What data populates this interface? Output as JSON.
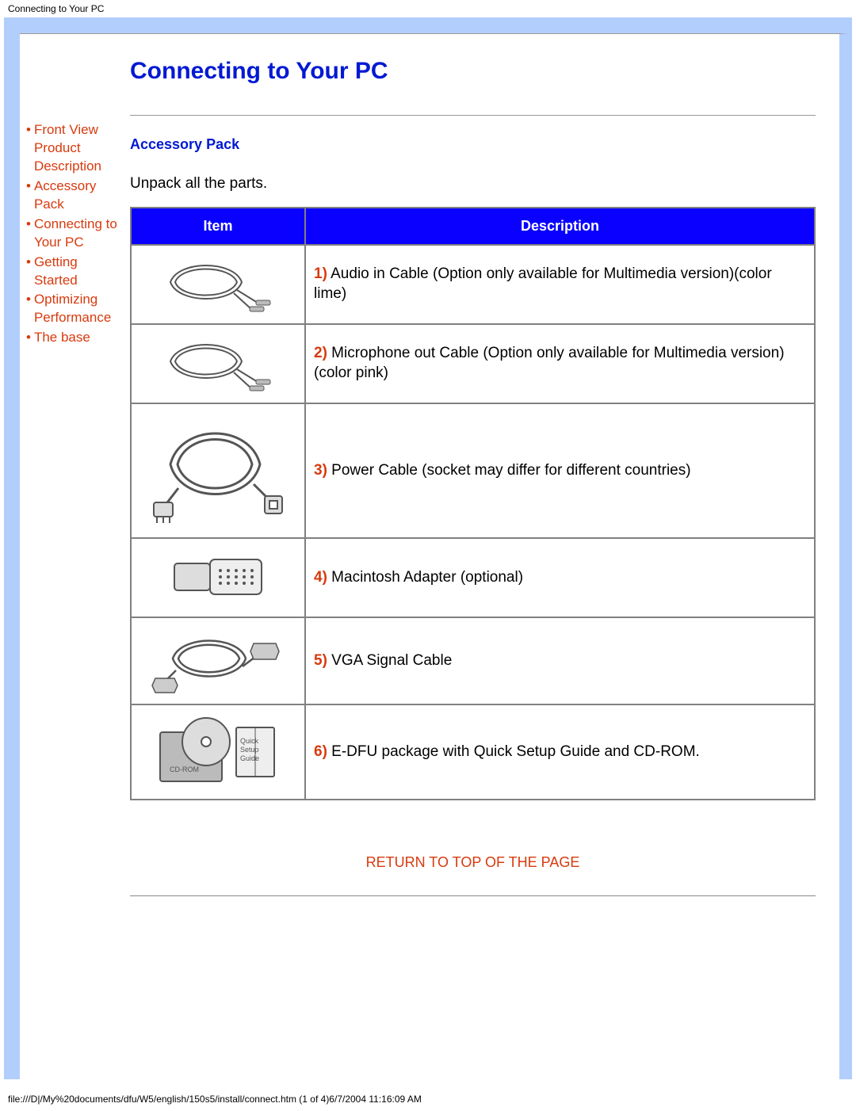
{
  "header": {
    "title": "Connecting to Your PC"
  },
  "sidebar": {
    "items": [
      {
        "label": "Front View Product Description"
      },
      {
        "label": "Accessory Pack"
      },
      {
        "label": "Connecting to Your PC"
      },
      {
        "label": "Getting Started"
      },
      {
        "label": "Optimizing Performance"
      },
      {
        "label": "The base"
      }
    ]
  },
  "main": {
    "heading": "Connecting to Your PC",
    "section_title": "Accessory Pack",
    "intro": "Unpack all the parts.",
    "table": {
      "headers": {
        "item": "Item",
        "description": "Description"
      },
      "rows": [
        {
          "num": "1)",
          "desc": " Audio in Cable (Option only available for Multimedia version)(color lime)"
        },
        {
          "num": "2)",
          "desc": " Microphone out Cable (Option only available for Multimedia version)(color pink)"
        },
        {
          "num": "3)",
          "desc": " Power Cable (socket may differ for different countries)"
        },
        {
          "num": "4)",
          "desc": " Macintosh Adapter (optional)"
        },
        {
          "num": "5)",
          "desc": " VGA Signal Cable"
        },
        {
          "num": "6)",
          "desc": " E-DFU package with Quick Setup Guide and CD-ROM."
        }
      ]
    },
    "return_link": "RETURN TO TOP OF THE PAGE"
  },
  "footer": {
    "text": "file:///D|/My%20documents/dfu/W5/english/150s5/install/connect.htm (1 of 4)6/7/2004 11:16:09 AM"
  }
}
